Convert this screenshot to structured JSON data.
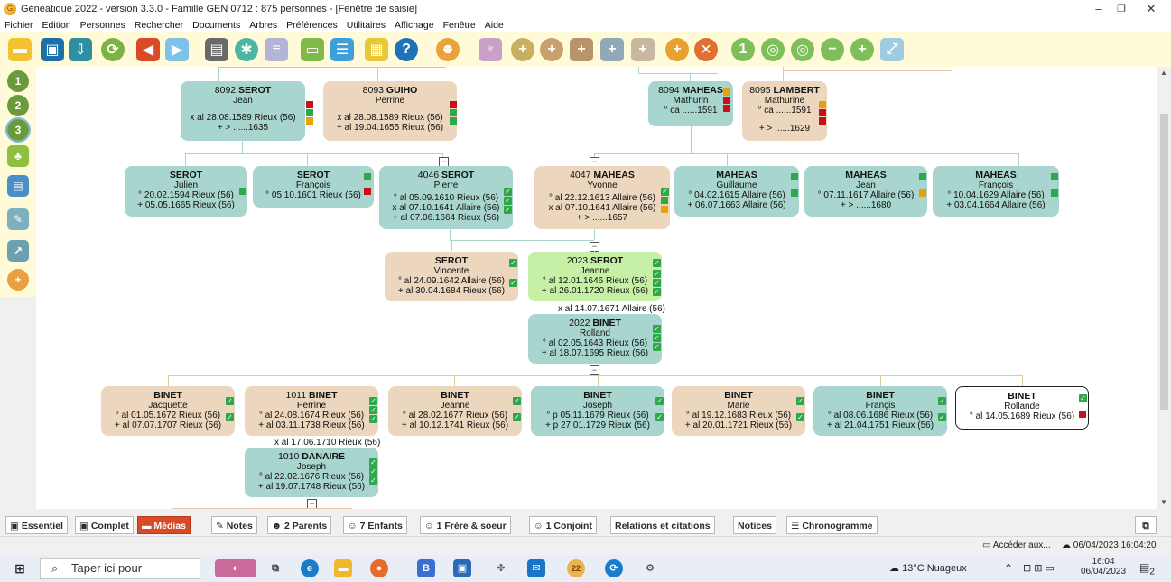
{
  "window": {
    "title": "Généatique 2022 - version 3.3.0 - Famille GEN 0712 : 875 personnes - [Fenêtre de saisie]",
    "app_icon": "genea-icon",
    "minimize": "–",
    "restore": "❐",
    "close": "✕"
  },
  "menu": [
    "Fichier",
    "Edition",
    "Personnes",
    "Rechercher",
    "Documents",
    "Arbres",
    "Préférences",
    "Utilitaires",
    "Affichage",
    "Fenêtre",
    "Aide"
  ],
  "toolbar_icons": [
    "folder-icon",
    "save-icon",
    "export-icon",
    "refresh-icon",
    "back-arrow-icon",
    "forward-arrow-icon",
    "print-icon",
    "settings-icon",
    "document-icon",
    "id-card-icon",
    "list-icon",
    "grid-icon",
    "help-icon",
    "person-search-icon",
    "tree-icon",
    "add-father-icon",
    "add-mother-icon",
    "add-parents-icon",
    "add-child-icon",
    "add-sibling-icon",
    "add-spouse-icon",
    "delete-person-icon",
    "zoom-1-icon",
    "zoom-out-icon",
    "zoom-fit-icon",
    "zoom-minus-icon",
    "zoom-plus-icon",
    "fullscreen-icon"
  ],
  "left_toolbar": {
    "items": [
      {
        "icon": "generation-1-icon",
        "label": "1"
      },
      {
        "icon": "generation-2-icon",
        "label": "2"
      },
      {
        "icon": "generation-3-icon",
        "label": "3"
      },
      {
        "icon": "tree-view-icon",
        "label": ""
      },
      {
        "icon": "printer-icon",
        "label": ""
      },
      {
        "icon": "tools-icon",
        "label": ""
      },
      {
        "icon": "chart-icon",
        "label": ""
      },
      {
        "icon": "calendar-add-icon",
        "label": ""
      }
    ]
  },
  "persons": {
    "p8092": {
      "id": "8092",
      "surname": "SEROT",
      "given": "Jean",
      "l1": "x al 28.08.1589 Rieux (56)",
      "l2": "+ > ......1635"
    },
    "p8093": {
      "id": "8093",
      "surname": "GUIHO",
      "given": "Perrine",
      "l1": "x al 28.08.1589 Rieux (56)",
      "l2": "+ al 19.04.1655 Rieux (56)"
    },
    "p8094": {
      "id": "8094",
      "surname": "MAHEAS",
      "given": "Mathurin",
      "l1": "° ca ......1591"
    },
    "p8095": {
      "id": "8095",
      "surname": "LAMBERT",
      "given": "Mathurine",
      "l1": "° ca ......1591",
      "l2": "+ > ......1629"
    },
    "s1": {
      "surname": "SEROT",
      "given": "Julien",
      "l1": "° 20.02.1594 Rieux (56)",
      "l2": "+ 05.05.1665 Rieux (56)"
    },
    "s2": {
      "surname": "SEROT",
      "given": "François",
      "l1": "° 05.10.1601 Rieux (56)"
    },
    "p4046": {
      "id": "4046",
      "surname": "SEROT",
      "given": "Pierre",
      "l1": "° al 05.09.1610 Rieux (56)",
      "l2": "x al 07.10.1641 Allaire (56)",
      "l3": "+ al 07.06.1664 Rieux (56)"
    },
    "p4047": {
      "id": "4047",
      "surname": "MAHEAS",
      "given": "Yvonne",
      "l1": "° al 22.12.1613 Allaire (56)",
      "l2": "x al 07.10.1641 Allaire (56)",
      "l3": "+ > ......1657"
    },
    "m1": {
      "surname": "MAHEAS",
      "given": "Guillaume",
      "l1": "° 04.02.1615 Allaire (56)",
      "l2": "+ 06.07.1663 Allaire (56)"
    },
    "m2": {
      "surname": "MAHEAS",
      "given": "Jean",
      "l1": "° 07.11.1617 Allaire (56)",
      "l2": "+ > ......1680"
    },
    "m3": {
      "surname": "MAHEAS",
      "given": "François",
      "l1": "° 10.04.1629 Allaire (56)",
      "l2": "+ 03.04.1664 Allaire (56)"
    },
    "v": {
      "surname": "SEROT",
      "given": "Vincente",
      "l1": "° al 24.09.1642 Allaire (56)",
      "l2": "+ al 30.04.1684 Rieux (56)"
    },
    "p2023": {
      "id": "2023",
      "surname": "SEROT",
      "given": "Jeanne",
      "l1": "° al 12.01.1646 Rieux (56)",
      "l2": "+ al 26.01.1720 Rieux (56)"
    },
    "marriage_2023": "x al 14.07.1671 Allaire (56)",
    "p2022": {
      "id": "2022",
      "surname": "BINET",
      "given": "Rolland",
      "l1": "° al 02.05.1643 Rieux (56)",
      "l2": "+ al 18.07.1695 Rieux (56)"
    },
    "c1": {
      "surname": "BINET",
      "given": "Jacquette",
      "l1": "° al 01.05.1672 Rieux (56)",
      "l2": "+ al 07.07.1707 Rieux (56)"
    },
    "p1011": {
      "id": "1011",
      "surname": "BINET",
      "given": "Perrine",
      "l1": "° al 24.08.1674 Rieux (56)",
      "l2": "+ al 03.11.1738 Rieux (56)"
    },
    "c3": {
      "surname": "BINET",
      "given": "Jeanne",
      "l1": "° al 28.02.1677 Rieux (56)",
      "l2": "+ al 10.12.1741 Rieux (56)"
    },
    "c4": {
      "surname": "BINET",
      "given": "Joseph",
      "l1": "° p 05.11.1679 Rieux (56)",
      "l2": "+ p 27.01.1729 Rieux (56)"
    },
    "c5": {
      "surname": "BINET",
      "given": "Marie",
      "l1": "° al 19.12.1683 Rieux (56)",
      "l2": "+ al 20.01.1721 Rieux (56)"
    },
    "c6": {
      "surname": "BINET",
      "given": "Françis",
      "l1": "° al 08.06.1686 Rieux (56)",
      "l2": "+ al 21.04.1751 Rieux (56)"
    },
    "c7": {
      "surname": "BINET",
      "given": "Rollande",
      "l1": "° al 14.05.1689 Rieux (56)"
    },
    "marriage_1011": "x al 17.06.1710 Rieux (56)",
    "p1010": {
      "id": "1010",
      "surname": "DANAIRE",
      "given": "Joseph",
      "l1": "° al 22.02.1676 Rieux (56)",
      "l2": "+ al 19.07.1748 Rieux (56)"
    }
  },
  "tabs": [
    {
      "icon": "essentiel-icon",
      "label": "Essentiel"
    },
    {
      "icon": "complet-icon",
      "label": "Complet"
    },
    {
      "icon": "medias-icon",
      "label": "Médias"
    },
    {
      "icon": "notes-icon",
      "label": "Notes"
    },
    {
      "icon": "parents-icon",
      "label": "2 Parents"
    },
    {
      "icon": "children-icon",
      "label": "7 Enfants"
    },
    {
      "icon": "sibling-icon",
      "label": "1 Frère & soeur"
    },
    {
      "icon": "spouse-icon",
      "label": "1 Conjoint"
    },
    {
      "icon": "",
      "label": "Relations et citations"
    },
    {
      "icon": "",
      "label": "Notices"
    },
    {
      "icon": "timeline-icon",
      "label": "Chronogramme"
    }
  ],
  "status": {
    "access": "Accéder aux...",
    "datetime": "06/04/2023 16:04:20"
  },
  "taskbar": {
    "search_placeholder": "Taper ici pour",
    "weather": "13°C  Nuageux",
    "time": "16:04",
    "date": "06/04/2023",
    "notif_count": "2"
  }
}
